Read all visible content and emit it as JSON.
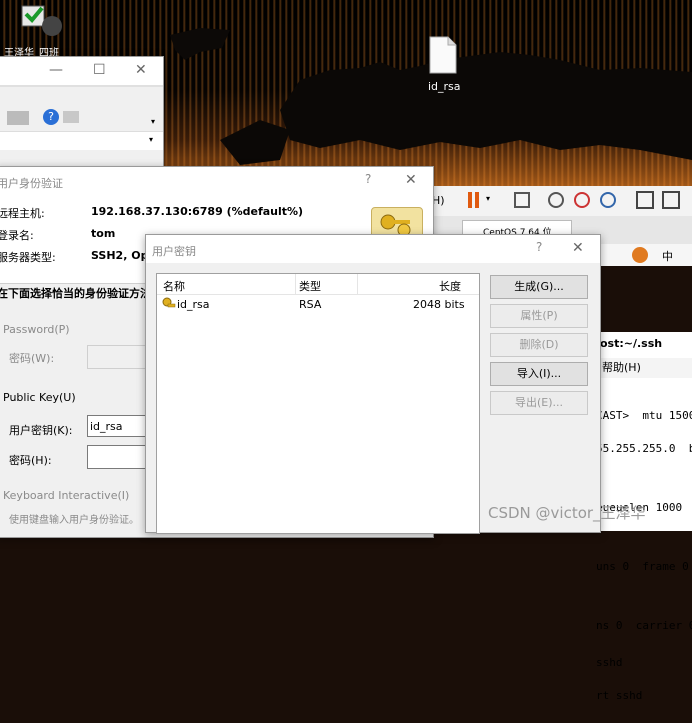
{
  "desktop": {
    "icon1_label": "王泽华_四班",
    "file_label": "id_rsa"
  },
  "bg_window": {
    "title": "",
    "controls": [
      "—",
      "☐",
      "✕"
    ]
  },
  "vm_toolbar": {
    "h_label": "H)",
    "tab_label": "CentOS 7 64 位",
    "right_label": "中"
  },
  "terminal": {
    "title": "ost:~/.ssh",
    "menu": "帮助(H)",
    "lines": [
      "CAST>  mtu 1500",
      "55.255.255.0  b",
      "",
      "eueuelen 1000  (E",
      "",
      "uns 0  frame 0",
      "",
      "ns 0  carrier 0",
      "sshd",
      "rt sshd"
    ]
  },
  "auth_dialog": {
    "title": "用户身份验证",
    "host_label": "远程主机:",
    "host_value": "192.168.37.130:6789 (%default%)",
    "login_label": "登录名:",
    "login_value": "tom",
    "server_label": "服务器类型:",
    "server_value": "SSH2, OpenSSH",
    "choose_label": "在下面选择恰当的身份验证方法",
    "password_section": "Password(P)",
    "password_label": "密码(W):",
    "pubkey_section": "Public Key(U)",
    "user_key_label": "用户密钥(K):",
    "user_key_value": "id_rsa",
    "passphrase_label": "密码(H):",
    "keyboard_section": "Keyboard Interactive(I)",
    "keyboard_hint": "使用键盘输入用户身份验证。",
    "help_icon": "?",
    "close_icon": "✕"
  },
  "key_dialog": {
    "title": "用户密钥",
    "help_icon": "?",
    "close_icon": "✕",
    "columns": [
      "名称",
      "类型",
      "长度"
    ],
    "rows": [
      {
        "name": "id_rsa",
        "type": "RSA",
        "length": "2048 bits"
      }
    ],
    "buttons": {
      "generate": "生成(G)...",
      "properties": "属性(P)",
      "delete": "删除(D)",
      "import": "导入(I)...",
      "export": "导出(E)..."
    }
  },
  "watermark": "CSDN @victor_王泽华"
}
